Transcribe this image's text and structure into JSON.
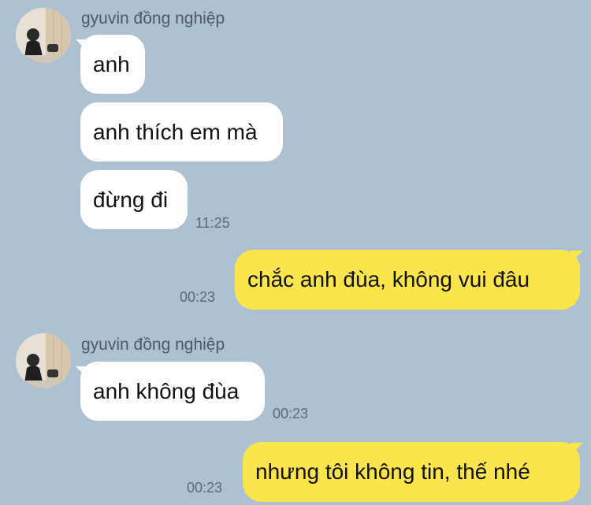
{
  "messages": [
    {
      "sender": "gyuvin đồng nghiệp",
      "text": "anh"
    },
    {
      "text": "anh thích em mà"
    },
    {
      "text": "đừng đi",
      "time": "11:25"
    },
    {
      "text": "chắc anh đùa, không vui đâu",
      "time": "00:23"
    },
    {
      "sender": "gyuvin đồng nghiệp",
      "text": "anh không đùa",
      "time": "00:23"
    },
    {
      "text": "nhưng tôi không tin, thế nhé",
      "time": "00:23"
    }
  ],
  "colors": {
    "background": "#adc1d2",
    "incoming_bubble": "#ffffff",
    "outgoing_bubble": "#fbe54d"
  }
}
